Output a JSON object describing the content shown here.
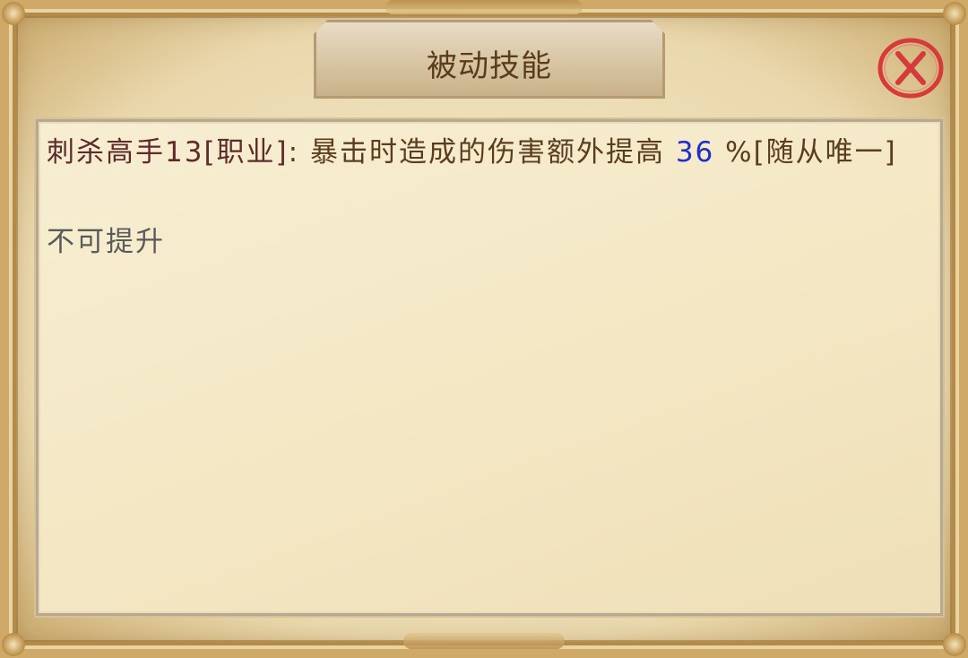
{
  "dialog": {
    "title": "被动技能",
    "close_icon": "close-x-icon",
    "accent_color": "#d63a3a"
  },
  "skill": {
    "name": "刺杀高手13[职业]",
    "separator": ":",
    "description_before": " 暴击时造成的伤害额外提高 ",
    "value": "36",
    "description_after": " %[随从唯一]",
    "note": "不可提升"
  }
}
